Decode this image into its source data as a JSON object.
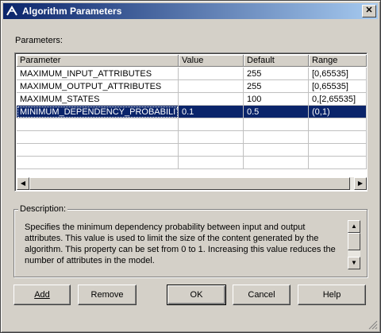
{
  "window": {
    "title": "Algorithm Parameters",
    "close_glyph": "✕"
  },
  "parameters_label": "Parameters:",
  "grid": {
    "columns": [
      "Parameter",
      "Value",
      "Default",
      "Range"
    ],
    "rows": [
      {
        "parameter": "MAXIMUM_INPUT_ATTRIBUTES",
        "value": "",
        "default": "255",
        "range": "[0,65535]",
        "selected": false
      },
      {
        "parameter": "MAXIMUM_OUTPUT_ATTRIBUTES",
        "value": "",
        "default": "255",
        "range": "[0,65535]",
        "selected": false
      },
      {
        "parameter": "MAXIMUM_STATES",
        "value": "",
        "default": "100",
        "range": "0,[2,65535]",
        "selected": false
      },
      {
        "parameter": "MINIMUM_DEPENDENCY_PROBABILITY",
        "value": "0.1",
        "default": "0.5",
        "range": "(0,1)",
        "selected": true
      }
    ]
  },
  "description": {
    "label": "Description:",
    "text": "Specifies the minimum dependency probability between input and output attributes. This value is used to limit the size of the content generated by the algorithm. This property can be set from 0 to 1. Increasing this value reduces the number of attributes in the model."
  },
  "buttons": {
    "add": "Add",
    "remove": "Remove",
    "ok": "OK",
    "cancel": "Cancel",
    "help": "Help"
  },
  "colors": {
    "selection": "#0a246a",
    "title_gradient_end": "#a6caf0",
    "face": "#d4d0c8"
  }
}
